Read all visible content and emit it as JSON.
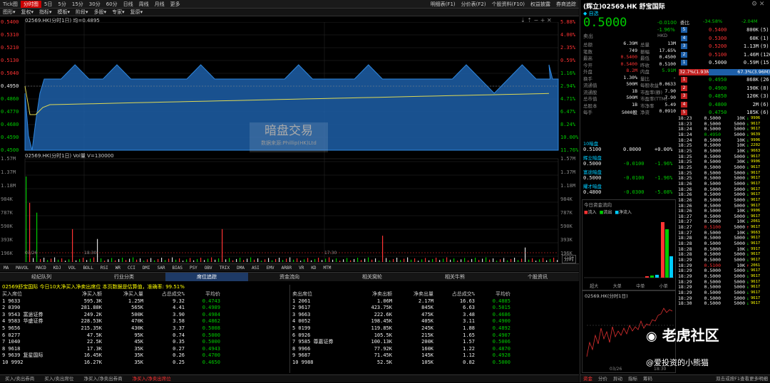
{
  "toolbar": {
    "items": [
      "Tick图",
      "分时图",
      "5日",
      "5分",
      "15分",
      "30分",
      "60分",
      "日线",
      "周线",
      "月线",
      "更多"
    ],
    "active": "分时图",
    "right_items": [
      "明细表(F1)",
      "分价表(F2)",
      "个股资料(F10)",
      "权益披露",
      "券商追踪"
    ]
  },
  "toolbar2": {
    "items": [
      "图形",
      "复权",
      "指标",
      "模板",
      "阶段",
      "多股",
      "专家",
      "复原"
    ]
  },
  "chart_title": "02569.HK(分时1日) 均=0.4895",
  "price_axis": [
    "0.5400",
    "0.5310",
    "0.5210",
    "0.5130",
    "0.5040",
    "0.4950",
    "0.4860",
    "0.4770",
    "0.4680",
    "0.4590",
    "0.4500"
  ],
  "pct_axis": [
    "5.88%",
    "4.00%",
    "2.35%",
    "0.59%",
    "1.16%",
    "2.94%",
    "4.71%",
    "6.47%",
    "8.24%",
    "10.00%",
    "11.76%"
  ],
  "watermark": {
    "title": "暗盘交易",
    "subtitle": "数据来源:Phillip(HK)Ltd"
  },
  "vol_title": "02569.HK(分时1日) Vol量 V=130000",
  "vol_axis": [
    "1.57M",
    "1.37M",
    "1.18M",
    "984K",
    "787K",
    "590K",
    "393K",
    "196K"
  ],
  "time_labels": [
    "03/26",
    "18:30",
    "17:30",
    "分时"
  ],
  "indicators": [
    "MA",
    "MAVOL",
    "MACD",
    "KDJ",
    "VOL",
    "BOLL",
    "RSI",
    "WR",
    "CCI",
    "DMI",
    "SAR",
    "BIAS",
    "PSY",
    "OBV",
    "TRIX",
    "DMA",
    "ASI",
    "EMV",
    "ARBR",
    "VR",
    "KD",
    "MTM"
  ],
  "tabs": [
    "经纪队列",
    "行业分类",
    "席位追踪",
    "资金流向",
    "相关窝轮",
    "相关牛熊",
    "个股资讯"
  ],
  "tabs_active": "席位追踪",
  "brokers_summary": "02569舒宝国际  今日10大净买入净卖出席位  本页数据是估算值，准确率: 99.51%",
  "buy_headers": [
    "买入席位",
    "净买入额",
    "净买入量",
    "占总成交%",
    "平均价"
  ],
  "buy_rows": [
    [
      "1 9633",
      "",
      "595.3K",
      "1.25M",
      "9.32",
      "0.4743"
    ],
    [
      "2 0390",
      "",
      "281.88K",
      "565K",
      "4.41",
      "0.4989"
    ],
    [
      "3 9543",
      "富途证券",
      "249.2K",
      "500K",
      "3.90",
      "0.4984"
    ],
    [
      "4 9583",
      "华盛证券",
      "228.53K",
      "470K",
      "3.58",
      "0.4862"
    ],
    [
      "5 9656",
      "",
      "215.35K",
      "430K",
      "3.37",
      "0.5008"
    ],
    [
      "6 0277",
      "",
      "47.5K",
      "95K",
      "0.74",
      "0.5000"
    ],
    [
      "7 1040",
      "",
      "22.5K",
      "45K",
      "0.35",
      "0.5000"
    ],
    [
      "8 9618",
      "",
      "17.3K",
      "35K",
      "0.27",
      "0.4943"
    ],
    [
      "9 9639",
      "复星国际",
      "16.45K",
      "35K",
      "0.26",
      "0.4700"
    ],
    [
      "10 9992",
      "",
      "16.27K",
      "35K",
      "0.25",
      "0.4650"
    ]
  ],
  "sell_headers": [
    "卖出席位",
    "净卖出额",
    "净卖出量",
    "占总成交%",
    "平均价"
  ],
  "sell_rows": [
    [
      "1 2061",
      "",
      "1.06M",
      "2.17M",
      "16.63",
      "0.4885"
    ],
    [
      "2 9617",
      "",
      "423.75K",
      "845K",
      "6.63",
      "0.5015"
    ],
    [
      "3 9663",
      "",
      "222.6K",
      "475K",
      "3.48",
      "0.4686"
    ],
    [
      "4 0052",
      "",
      "198.45K",
      "405K",
      "3.11",
      "0.4900"
    ],
    [
      "5 0199",
      "",
      "119.85K",
      "245K",
      "1.88",
      "0.4892"
    ],
    [
      "6 0926",
      "",
      "105.5K",
      "215K",
      "1.65",
      "0.4907"
    ],
    [
      "7 9585",
      "尊嘉证券",
      "100.13K",
      "200K",
      "1.57",
      "0.5006"
    ],
    [
      "8 9966",
      "",
      "77.92K",
      "160K",
      "1.22",
      "0.4870"
    ],
    [
      "9 9687",
      "",
      "71.45K",
      "145K",
      "1.12",
      "0.4928"
    ],
    [
      "10 9988",
      "",
      "52.5K",
      "105K",
      "0.82",
      "0.5000"
    ]
  ],
  "bottom_tabs": [
    "买入/卖出券商",
    "买入/卖出席位",
    "净买入/净卖出券商",
    "净买入/净卖出席位"
  ],
  "bottom_active": "净买入/净卖出席位",
  "quote": {
    "title": "(辉立)02569.HK 舒宝国际",
    "price": "0.5000",
    "change": "-0.0100",
    "change_pct": "-1.96%",
    "wb": "-34.58%",
    "wb_diff": "-2.04M",
    "fields": [
      [
        "总额",
        "6.39M",
        "总量",
        "13M"
      ],
      [
        "笔数",
        "749",
        "振幅",
        "17.65%"
      ],
      [
        "最高",
        "0.5400",
        "最低",
        "0.4500"
      ],
      [
        "今开",
        "0.5400",
        "昨收",
        "0.5100"
      ],
      [
        "外盘",
        "8.2M",
        "内盘",
        "5.91M"
      ],
      [
        "换手",
        "1.30%",
        "量比",
        "-"
      ],
      [
        "流通值",
        "500M",
        "每股收益",
        "0.0633"
      ],
      [
        "流通股",
        "1B",
        "市盈率(静)",
        "7.90"
      ],
      [
        "总市值",
        "500M",
        "市盈率(TTM)",
        "7.90"
      ],
      [
        "总股本",
        "1B",
        "市净率",
        "5.49"
      ],
      [
        "每手",
        "5000股",
        "净资",
        "0.0910"
      ]
    ]
  },
  "asks": [
    [
      "5",
      "0.5400",
      "800K",
      "(5)"
    ],
    [
      "4",
      "0.5300",
      "60K",
      "(1)"
    ],
    [
      "3",
      "0.5200",
      "1.13M",
      "(9)"
    ],
    [
      "2",
      "0.5100",
      "1.46M",
      "(126)"
    ],
    [
      "1",
      "0.5000",
      "0.59M",
      "(15)"
    ]
  ],
  "bids": [
    [
      "1",
      "0.4950",
      "868K",
      "(26)"
    ],
    [
      "2",
      "0.4900",
      "190K",
      "(8)"
    ],
    [
      "3",
      "0.4850",
      "120K",
      "(3)"
    ],
    [
      "4",
      "0.4800",
      "2M",
      "(6)"
    ],
    [
      "5",
      "0.4750",
      "185K",
      "(6)"
    ]
  ],
  "ratio": {
    "buy": "32.7%(1.93M)",
    "sell": "67.3%(3.96M)"
  },
  "related": [
    [
      "10暗盘",
      "0.5100",
      "0.0000",
      "+0.00%"
    ],
    [
      "辉立暗盘",
      "0.5000",
      "-0.0100",
      "-1.96%"
    ],
    [
      "富途暗盘",
      "0.5000",
      "-0.0100",
      "-1.96%"
    ],
    [
      "耀才暗盘",
      "0.4800",
      "-0.0300",
      "-5.08%"
    ]
  ],
  "flow_title": "今日资金流向",
  "flow_legend": [
    "流入",
    "流出",
    "净流入"
  ],
  "flow_labels": [
    "超大",
    "大单",
    "中单",
    "小单"
  ],
  "mini_title": "02569.HK(分时1日)",
  "mini_labels": [
    "03/26",
    "18:30"
  ],
  "ticks": [
    [
      "18:23",
      "0.5000",
      "10K",
      "9906"
    ],
    [
      "18:23",
      "0.5000",
      "5000",
      "9617"
    ],
    [
      "18:24",
      "0.5000",
      "5000",
      "9617"
    ],
    [
      "18:24",
      "0.4950",
      "5000",
      "9639"
    ],
    [
      "18:24",
      "0.5000",
      "10K",
      "9906"
    ],
    [
      "18:25",
      "0.5000",
      "10K",
      "2202"
    ],
    [
      "18:25",
      "0.5000",
      "10K",
      "9663"
    ],
    [
      "18:25",
      "0.5000",
      "5000",
      "9617"
    ],
    [
      "18:25",
      "0.5000",
      "30K",
      "9906"
    ],
    [
      "18:25",
      "0.5000",
      "5000",
      "9617"
    ],
    [
      "18:25",
      "0.5000",
      "5000",
      "9617"
    ],
    [
      "18:25",
      "0.5000",
      "5000",
      "9617"
    ],
    [
      "18:26",
      "0.5000",
      "5000",
      "9617"
    ],
    [
      "18:26",
      "0.5000",
      "5000",
      "9617"
    ],
    [
      "18:26",
      "0.5000",
      "5000",
      "9617"
    ],
    [
      "18:26",
      "0.5000",
      "5000",
      "9617"
    ],
    [
      "18:26",
      "0.5000",
      "5000",
      "9617"
    ],
    [
      "18:26",
      "0.5000",
      "10K",
      "9906"
    ],
    [
      "18:27",
      "0.5000",
      "5000",
      "9617"
    ],
    [
      "18:27",
      "0.5000",
      "10K",
      "2061"
    ],
    [
      "18:27",
      "0.5100",
      "5000",
      "9617"
    ],
    [
      "18:27",
      "0.5000",
      "10K",
      "9663"
    ],
    [
      "18:28",
      "0.5000",
      "5000",
      "9617"
    ],
    [
      "18:28",
      "0.5000",
      "5000",
      "9617"
    ],
    [
      "18:28",
      "0.5000",
      "10K",
      "9917"
    ],
    [
      "18:28",
      "0.5000",
      "5000",
      "9617"
    ],
    [
      "18:29",
      "0.5000",
      "5000",
      "9617"
    ],
    [
      "18:29",
      "0.5100",
      "10K",
      "2061"
    ],
    [
      "18:29",
      "0.5000",
      "5000",
      "9617"
    ],
    [
      "18:29",
      "0.5000",
      "5000",
      "9617"
    ],
    [
      "18:29",
      "0.5000",
      "5000",
      "9617"
    ],
    [
      "18:29",
      "0.5000",
      "5000",
      "9617"
    ],
    [
      "18:29",
      "0.5000",
      "5000",
      "9617"
    ],
    [
      "18:29",
      "0.5000",
      "5000",
      "9617"
    ],
    [
      "18:30",
      "0.5000",
      "5000",
      "9617"
    ]
  ],
  "right_bottom_tabs": [
    "资金",
    "分价",
    "异动",
    "指标",
    "筹码"
  ],
  "status": "双击或按F1查看更多明细",
  "brand": {
    "logo": "老虎社区",
    "handle": "@爱投资的小熊猫"
  },
  "colors": {
    "up": "#ff3333",
    "down": "#00cc00",
    "area": "#1d5fa8"
  }
}
